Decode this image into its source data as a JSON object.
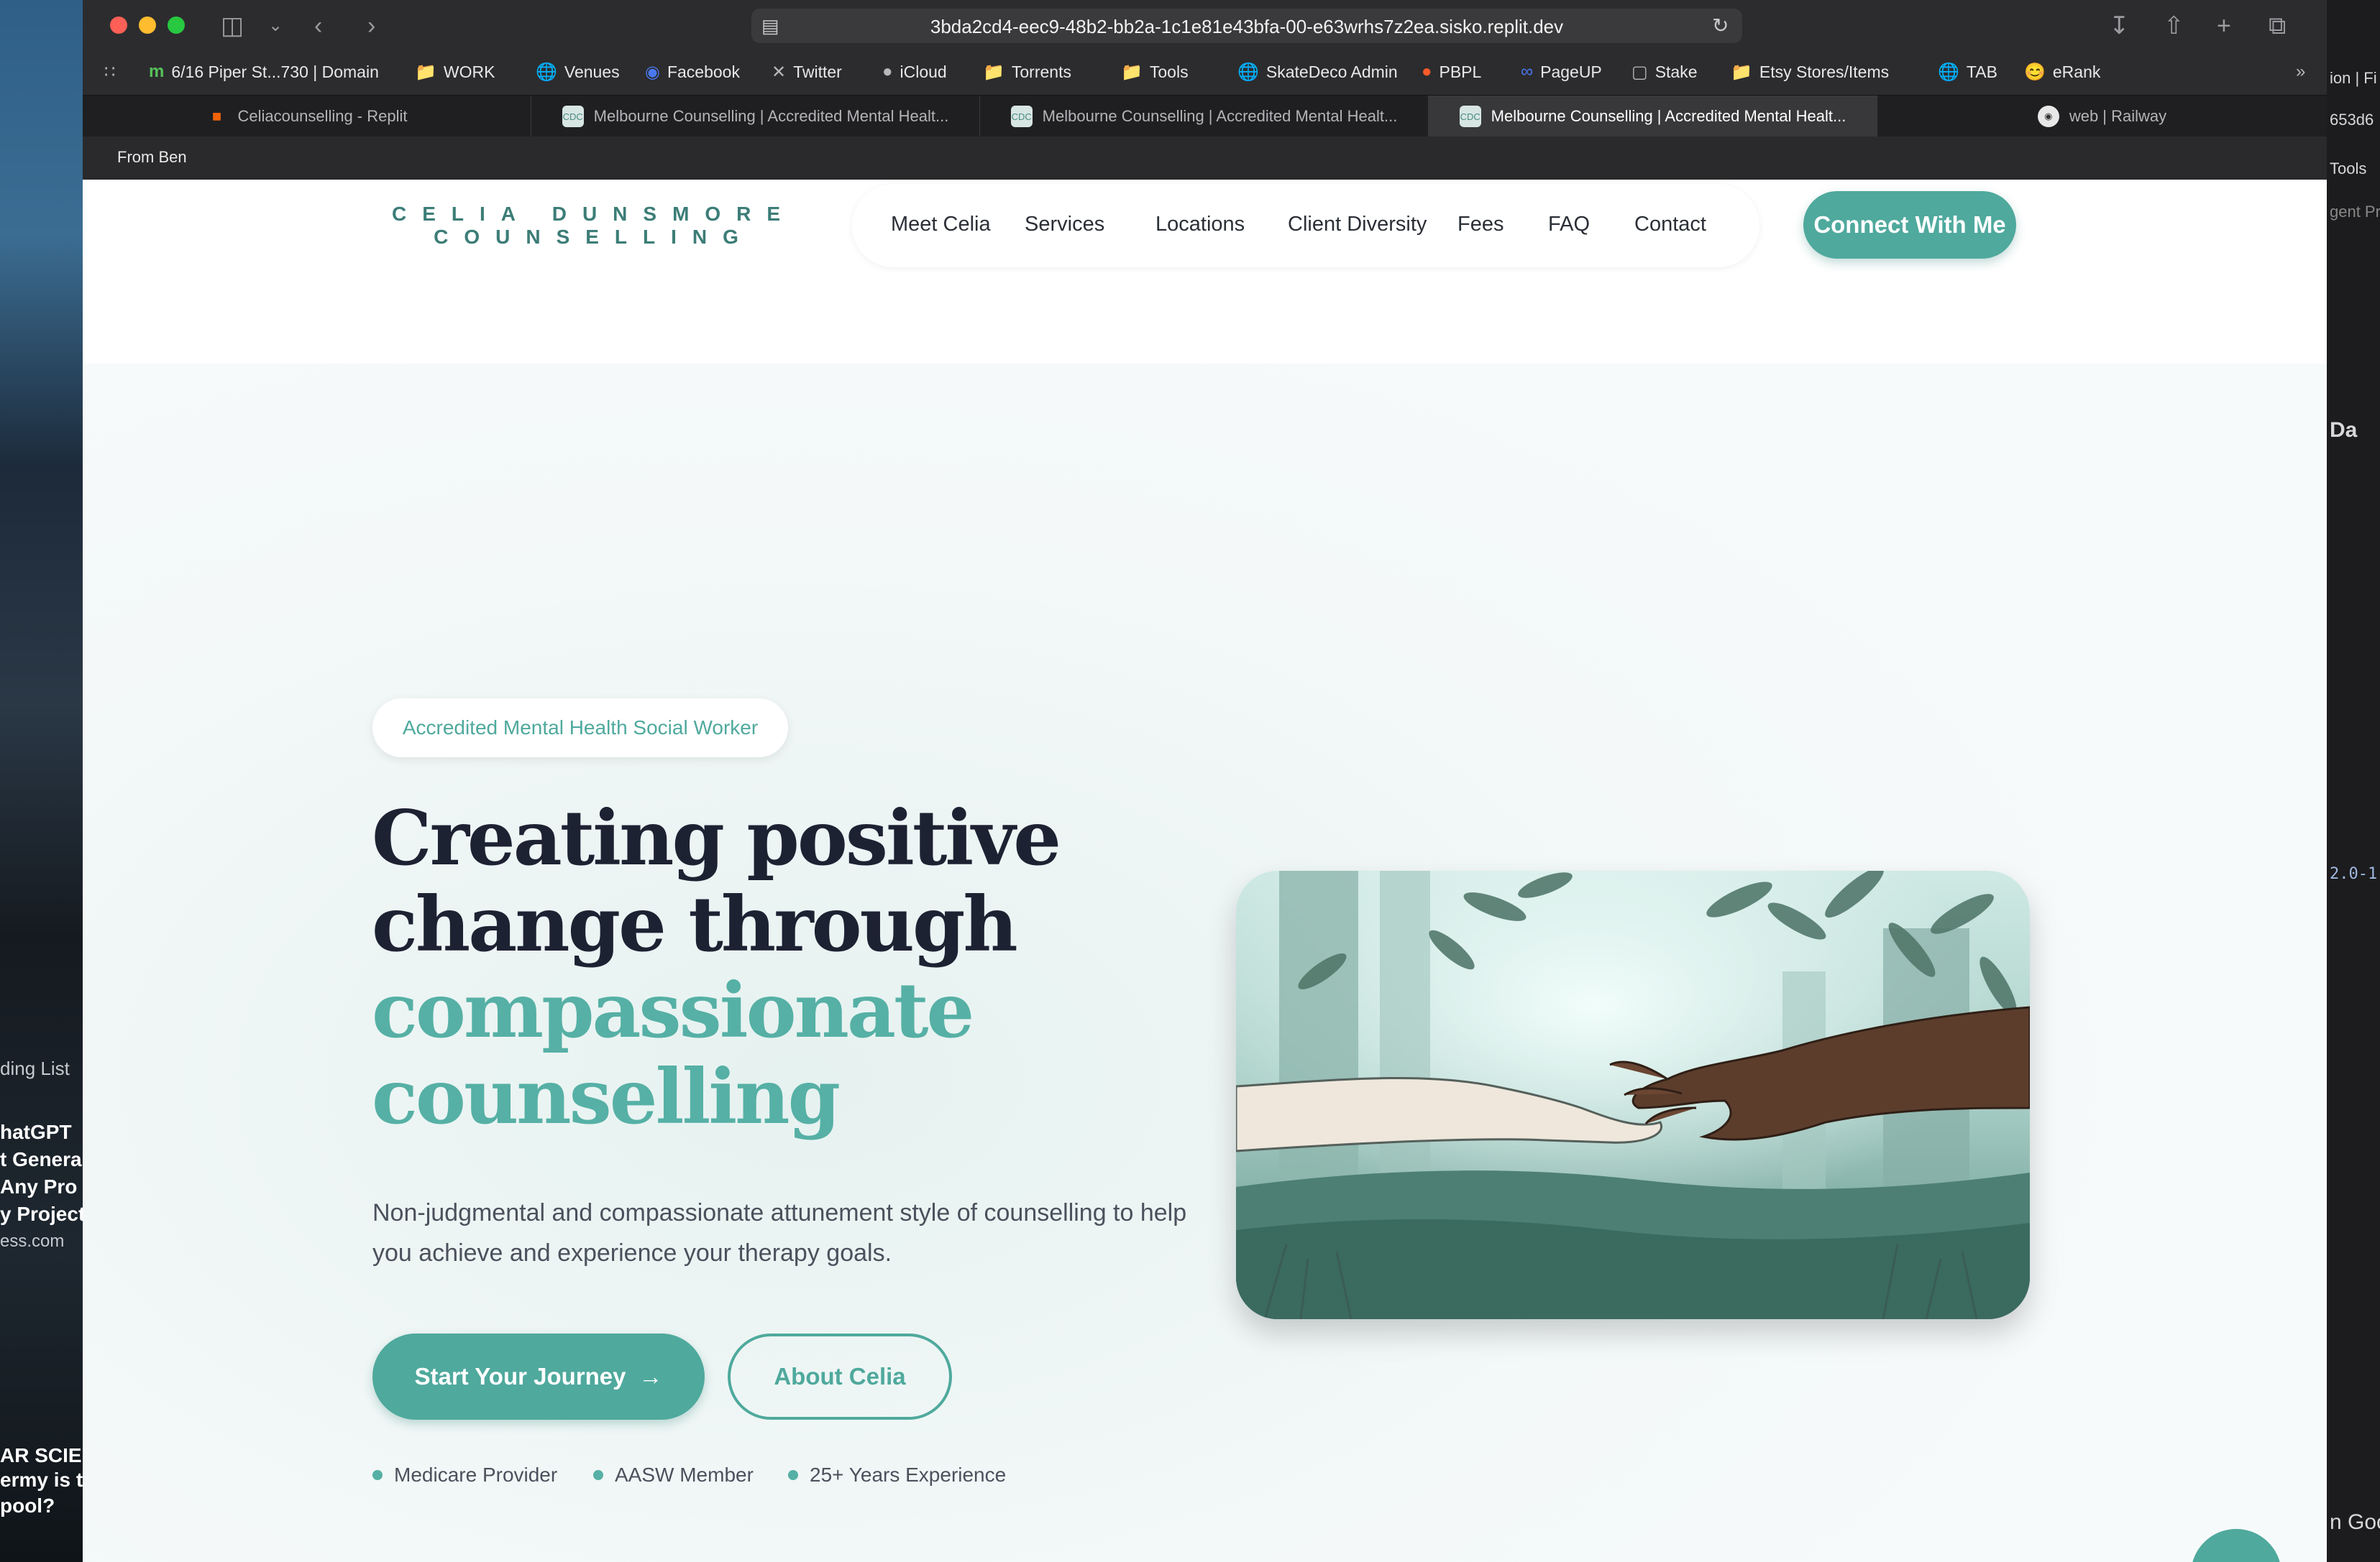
{
  "browser": {
    "url": "3bda2cd4-eec9-48b2-bb2a-1c1e81e43bfa-00-e63wrhs7z2ea.sisko.replit.dev",
    "bookmarks": [
      {
        "label": "6/16 Piper St...730 | Domain",
        "icon": "domain-icon"
      },
      {
        "label": "WORK",
        "icon": "folder-icon"
      },
      {
        "label": "Venues",
        "icon": "globe-icon"
      },
      {
        "label": "Facebook",
        "icon": "facebook-icon"
      },
      {
        "label": "Twitter",
        "icon": "x-icon"
      },
      {
        "label": "iCloud",
        "icon": "apple-icon"
      },
      {
        "label": "Torrents",
        "icon": "folder-icon"
      },
      {
        "label": "Tools",
        "icon": "folder-icon"
      },
      {
        "label": "SkateDeco Admin",
        "icon": "globe-icon"
      },
      {
        "label": "PBPL",
        "icon": "reddit-icon"
      },
      {
        "label": "PageUP",
        "icon": "pageup-icon"
      },
      {
        "label": "Stake",
        "icon": "stake-icon"
      },
      {
        "label": "Etsy Stores/Items",
        "icon": "folder-icon"
      },
      {
        "label": "TAB",
        "icon": "globe-icon"
      },
      {
        "label": "eRank",
        "icon": "emoji-icon"
      }
    ],
    "tabs": [
      {
        "label": "Celiacounselling - Replit",
        "active": false
      },
      {
        "label": "Melbourne Counselling | Accredited Mental Healt...",
        "active": false
      },
      {
        "label": "Melbourne Counselling | Accredited Mental Healt...",
        "active": false
      },
      {
        "label": "Melbourne Counselling | Accredited Mental Healt...",
        "active": true
      },
      {
        "label": "web | Railway",
        "active": false
      }
    ],
    "from_label": "From Ben"
  },
  "site": {
    "logo_line1": "CELIA DUNSMORE",
    "logo_line2": "COUNSELLING",
    "nav": [
      "Meet Celia",
      "Services",
      "Locations",
      "Client Diversity",
      "Fees",
      "FAQ",
      "Contact"
    ],
    "cta": "Connect With Me"
  },
  "hero": {
    "badge": "Accredited Mental Health Social Worker",
    "title_line1": "Creating positive",
    "title_line2": "change through",
    "title_accent1": "compassionate",
    "title_accent2": "counselling",
    "lead": "Non-judgmental and compassionate attunement style of counselling to help you achieve and experience your therapy goals.",
    "primary_button": "Start Your Journey",
    "primary_arrow": "→",
    "secondary_button": "About Celia",
    "features": [
      "Medicare Provider",
      "AASW Member",
      "25+ Years Experience"
    ]
  },
  "desktop_left": [
    "ding List",
    "hatGPT",
    "t Genera",
    "Any Pro",
    "y Project",
    "ess.com",
    "AR SCIEN",
    "ermy is th",
    "pool?"
  ],
  "desktop_right": [
    "ion | Fi",
    "653d6",
    "Tools",
    "gent Pr",
    "Da",
    "2.0-1",
    "n Goo"
  ],
  "colors": {
    "accent": "#4fa99d",
    "heading": "#1d2233",
    "accent_text": "#56b0a5"
  }
}
